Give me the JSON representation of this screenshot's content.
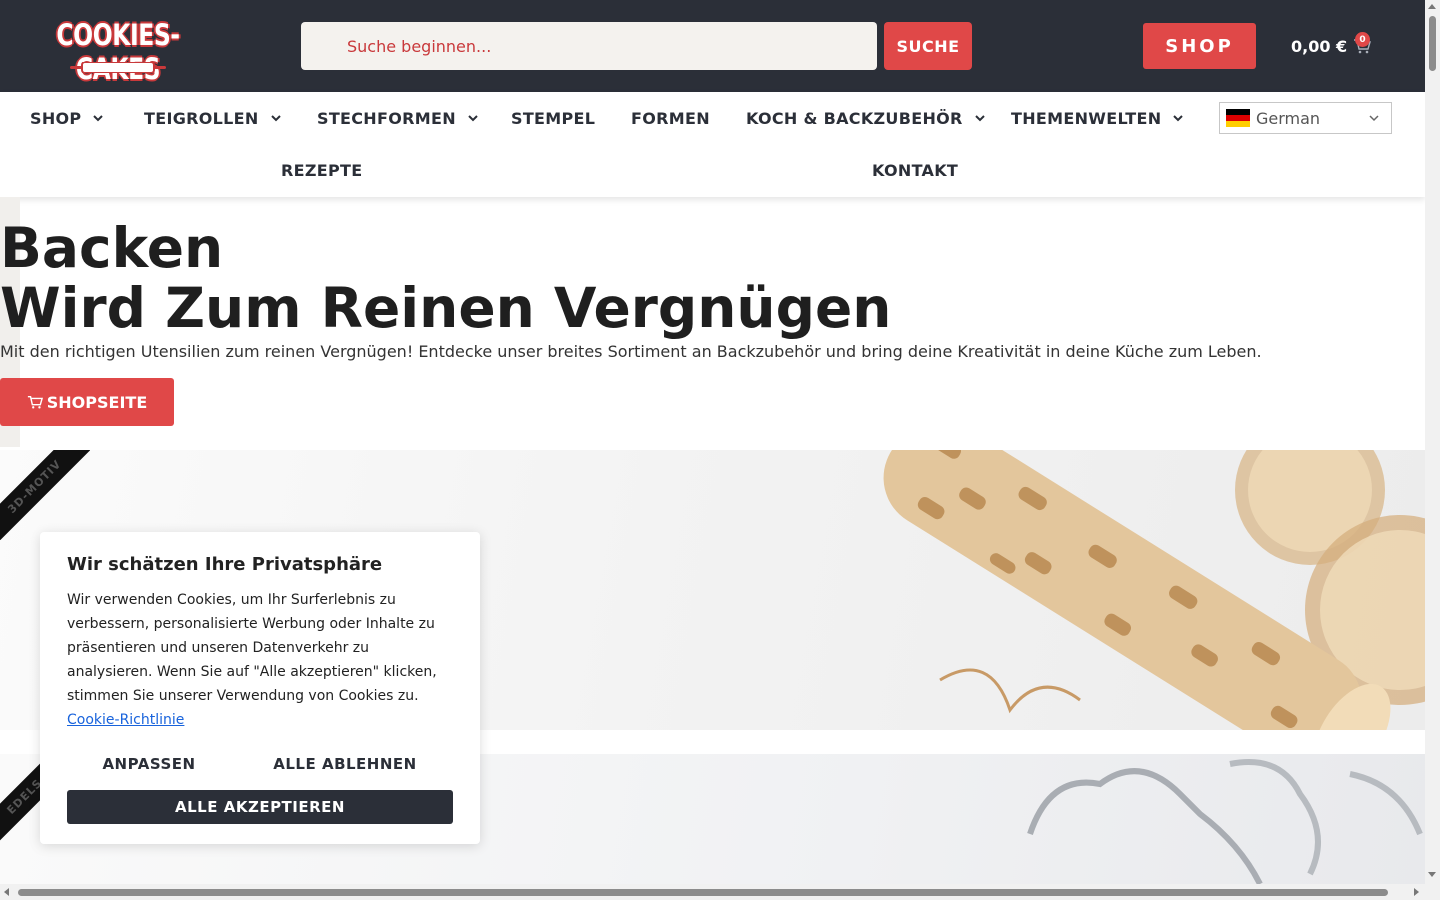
{
  "header": {
    "logo_text": "COOKIES-CAKES",
    "search_placeholder": "Suche beginnen...",
    "search_button": "SUCHE",
    "shop_button": "SHOP",
    "cart_total": "0,00 €",
    "cart_count": "0"
  },
  "nav": {
    "items": [
      {
        "label": "SHOP",
        "has_dropdown": true
      },
      {
        "label": "TEIGROLLEN",
        "has_dropdown": true
      },
      {
        "label": "STECHFORMEN",
        "has_dropdown": true
      },
      {
        "label": "STEMPEL",
        "has_dropdown": false
      },
      {
        "label": "FORMEN",
        "has_dropdown": false
      },
      {
        "label": "KOCH & BACKZUBEHÖR",
        "has_dropdown": true
      },
      {
        "label": "THEMENWELTEN",
        "has_dropdown": true
      },
      {
        "label": "REZEPTE",
        "has_dropdown": false
      },
      {
        "label": "KONTAKT",
        "has_dropdown": false
      }
    ],
    "language": "German"
  },
  "hero": {
    "title_line1": "Backen",
    "title_line2": "Wird Zum Reinen Vergnügen",
    "subtitle": "Mit den richtigen Utensilien zum reinen Vergnügen! Entdecke unser breites Sortiment an Backzubehör und bring deine Kreativität in deine Küche zum Leben.",
    "button": "SHOPSEITE"
  },
  "banners": [
    {
      "ribbon": "3D-MOTIV"
    },
    {
      "ribbon": "EDELS"
    }
  ],
  "cookie_dialog": {
    "title": "Wir schätzen Ihre Privatsphäre",
    "text": "Wir verwenden Cookies, um Ihr Surferlebnis zu verbessern, personalisierte Werbung oder Inhalte zu präsentieren und unseren Datenverkehr zu analysieren. Wenn Sie auf \"Alle akzeptieren\" klicken, stimmen Sie unserer Verwendung von Cookies zu.",
    "policy_link": "Cookie-Richtlinie",
    "customize": "ANPASSEN",
    "reject_all": "ALLE ABLEHNEN",
    "accept_all": "ALLE AKZEPTIEREN"
  },
  "colors": {
    "header_bg": "#2b2f38",
    "accent": "#e04848",
    "link": "#1863dc"
  }
}
